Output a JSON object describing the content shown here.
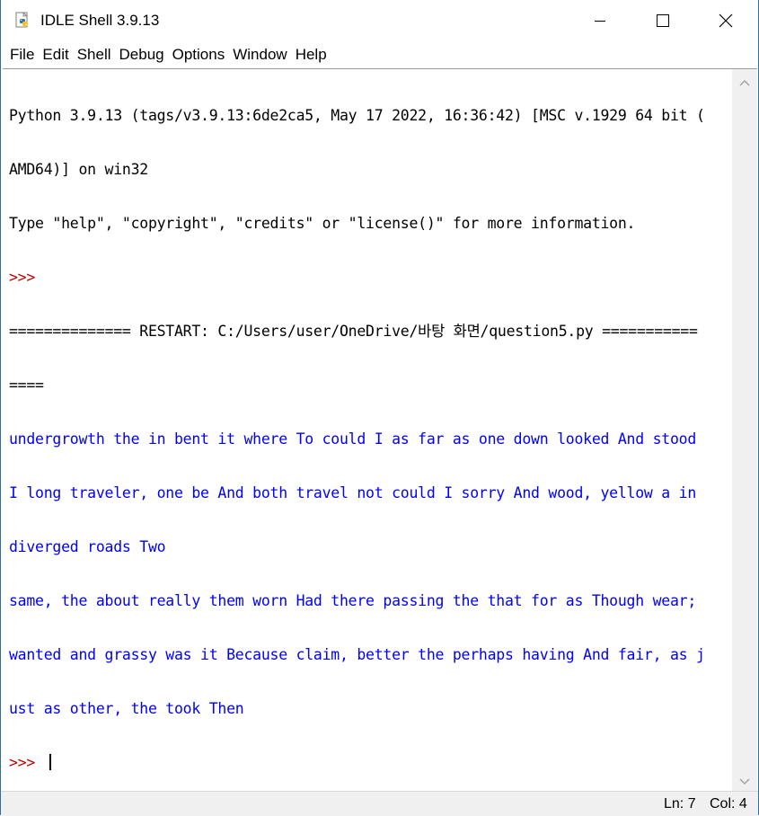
{
  "window": {
    "title": "IDLE Shell 3.9.13"
  },
  "menu": {
    "items": [
      "File",
      "Edit",
      "Shell",
      "Debug",
      "Options",
      "Window",
      "Help"
    ]
  },
  "shell": {
    "lines": [
      {
        "text": "Python 3.9.13 (tags/v3.9.13:6de2ca5, May 17 2022, 16:36:42) [MSC v.1929 64 bit (",
        "style": "normal"
      },
      {
        "text": "AMD64)] on win32",
        "style": "normal"
      },
      {
        "text": "Type \"help\", \"copyright\", \"credits\" or \"license()\" for more information.",
        "style": "normal"
      },
      {
        "text": ">>> ",
        "style": "prompt"
      },
      {
        "text": "============== RESTART: C:/Users/user/OneDrive/바탕 화면/question5.py ===========",
        "style": "normal"
      },
      {
        "text": "====",
        "style": "normal"
      },
      {
        "text": "undergrowth the in bent it where To could I as far as one down looked And stood",
        "style": "out"
      },
      {
        "text": "I long traveler, one be And both travel not could I sorry And wood, yellow a in",
        "style": "out"
      },
      {
        "text": "diverged roads Two",
        "style": "out"
      },
      {
        "text": "same, the about really them worn Had there passing the that for as Though wear;",
        "style": "out"
      },
      {
        "text": "wanted and grassy was it Because claim, better the perhaps having And fair, as j",
        "style": "out"
      },
      {
        "text": "ust as other, the took Then",
        "style": "out"
      }
    ],
    "current_prompt": ">>> "
  },
  "status": {
    "ln": "Ln: 7",
    "col": "Col: 4"
  },
  "colors": {
    "prompt": "#c00000",
    "output": "#0000ff",
    "text": "#000000"
  },
  "icons": [
    "python-idle-icon",
    "minimize-icon",
    "maximize-icon",
    "close-icon",
    "scroll-up-arrow-icon",
    "scroll-down-arrow-icon"
  ]
}
